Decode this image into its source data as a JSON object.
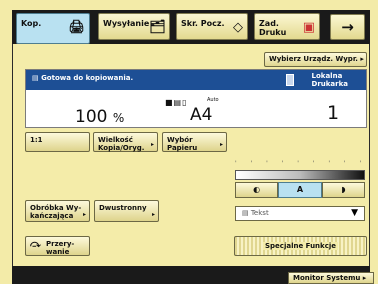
{
  "tabs": [
    {
      "label": "Kop.",
      "icon": "copy-icon",
      "active": true
    },
    {
      "label": "Wysyłanie",
      "icon": "send-icon",
      "active": false
    },
    {
      "label": "Skr. Pocz.",
      "icon": "mailbox-icon",
      "active": false
    },
    {
      "label": "Zad. Druku",
      "icon": "print-job-icon",
      "active": false
    }
  ],
  "nav_arrow": "→",
  "select_printer": "Wybierz Urządz. Wypr. ▸",
  "status": {
    "message": "Gotowa do kopiowania.",
    "printer_line1": "Lokalna",
    "printer_line2": "Drukarka",
    "zoom": "100",
    "zoom_unit": "%",
    "paper_mode": "Auto",
    "paper_size": "A4",
    "copies": "1"
  },
  "buttons": {
    "ratio": "1:1",
    "size_line1": "Wielkość",
    "size_line2": "Kopia/Oryg.",
    "paper_line1": "Wybór",
    "paper_line2": "Papieru",
    "finishing_line1": "Obróbka Wy-",
    "finishing_line2": "kańczająca",
    "duplex": "Dwustronny",
    "interrupt_line1": "Przery-",
    "interrupt_line2": "wanie",
    "special": "Specjalne Funkcje"
  },
  "density": {
    "light": "◐",
    "auto": "A",
    "dark": "◗"
  },
  "original_type": "Tekst",
  "monitor": "Monitor Systemu ▸",
  "colors": {
    "accent": "#1d4f95",
    "active_tab": "#b9e1f1",
    "background": "#f3eba8"
  }
}
